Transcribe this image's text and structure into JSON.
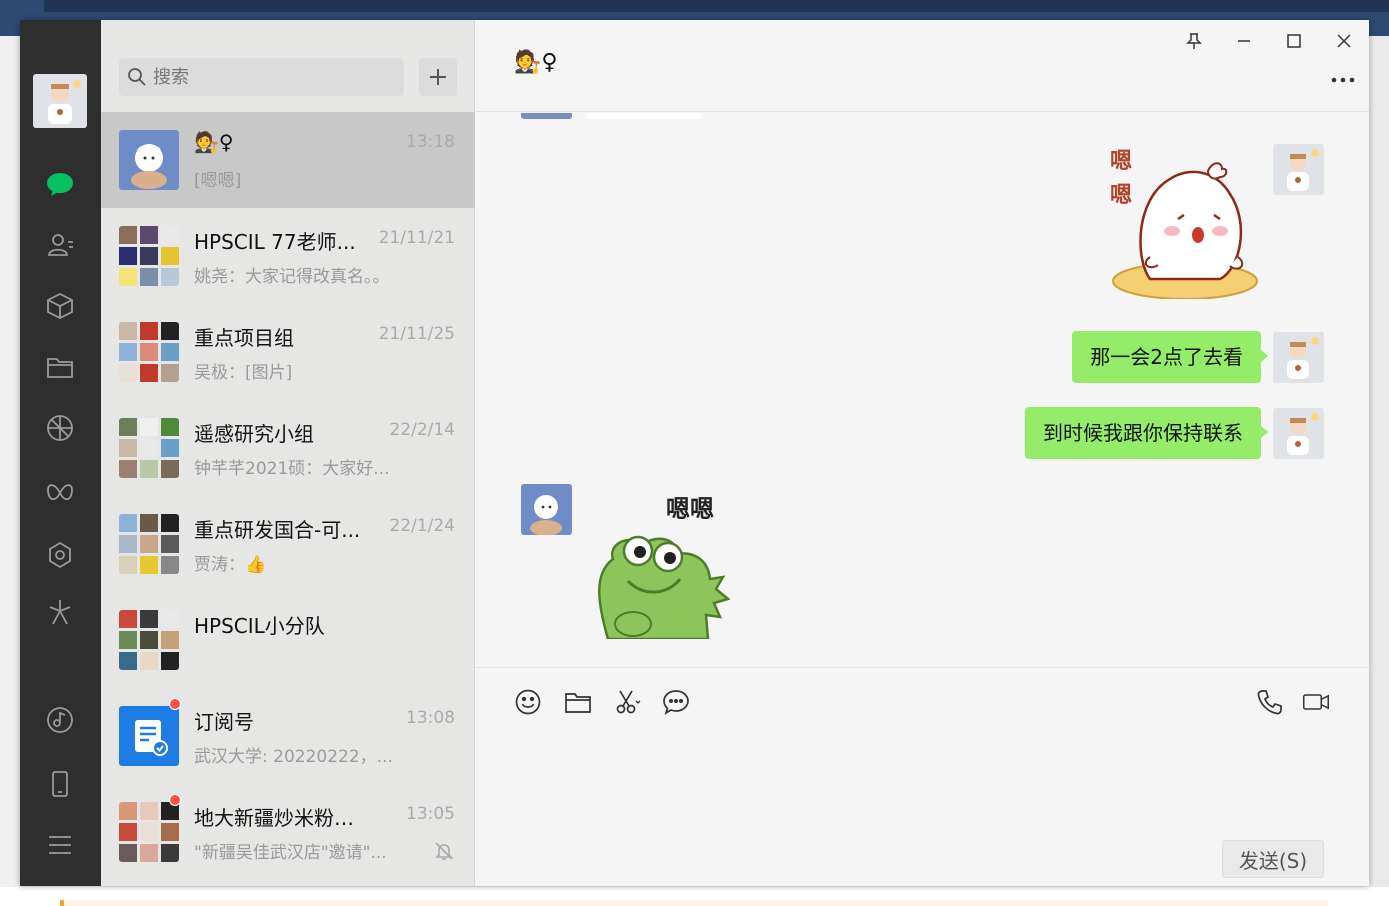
{
  "search": {
    "placeholder": "搜索"
  },
  "conversations": [
    {
      "name": "🧑‍⚖️♀",
      "time": "13:18",
      "preview": "[嗯嗯]"
    },
    {
      "name": "HPSCIL 77老师...",
      "time": "21/11/21",
      "preview": "姚尧：大家记得改真名。。"
    },
    {
      "name": "重点项目组",
      "time": "21/11/25",
      "preview": "吴极：[图片]"
    },
    {
      "name": "遥感研究小组",
      "time": "22/2/14",
      "preview": "钟芊芊2021硕：大家好..."
    },
    {
      "name": "重点研发国合-可...",
      "time": "22/1/24",
      "preview": "贾涛：👍"
    },
    {
      "name": "HPSCIL小分队",
      "time": "",
      "preview": ""
    },
    {
      "name": "订阅号",
      "time": "13:08",
      "preview": "武汉大学: 20220222，..."
    },
    {
      "name": "地大新疆炒米粉预定...",
      "time": "13:05",
      "preview": "\"新疆吴佳武汉店\"邀请\"..."
    }
  ],
  "chat": {
    "title": "🧑‍⚖️♀",
    "messages": [
      {
        "text": "那一会2点了去看"
      },
      {
        "text": "到时候我跟你保持联系"
      }
    ],
    "sticker_text": "嗯嗯",
    "sticker_mini_text_1": "嗯",
    "sticker_mini_text_2": "嗯"
  },
  "composer": {
    "send_label": "发送(S)"
  },
  "colors": {
    "accent": "#07c160",
    "bubble": "#95ec69",
    "nav_bg": "#2e2e2e",
    "list_bg": "#e6e6e5",
    "active_item": "#c9c8c8",
    "badge": "#fa5151"
  },
  "icons": {
    "nav": [
      "chat-icon",
      "contacts-icon",
      "favorites-icon",
      "files-icon",
      "moments-icon",
      "channels-icon",
      "mini-program-icon",
      "search-feature-icon",
      "music-icon",
      "phone-icon",
      "menu-icon"
    ],
    "window": [
      "pin-icon",
      "minimize-icon",
      "maximize-icon",
      "close-icon",
      "more-icon"
    ],
    "toolbar": [
      "emoji-icon",
      "folder-icon",
      "scissors-icon",
      "chat-bubble-icon",
      "voice-call-icon",
      "video-call-icon"
    ]
  }
}
